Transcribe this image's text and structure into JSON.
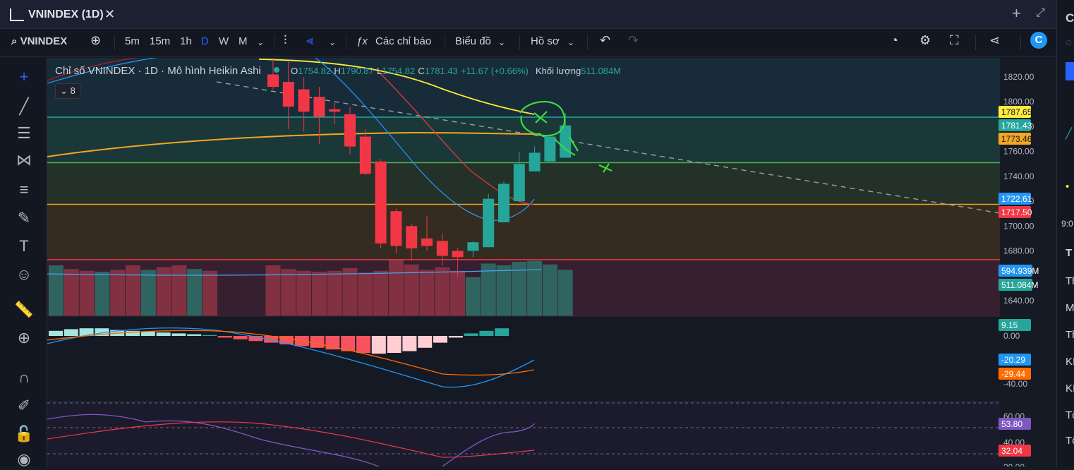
{
  "window": {
    "title": "VNINDEX (1D)",
    "close_glyph": "✕",
    "plus_glyph": "+",
    "expand_glyph": "⤢"
  },
  "toolbar": {
    "symbol": "VNINDEX",
    "intervals": [
      "5m",
      "15m",
      "1h",
      "D",
      "W",
      "M"
    ],
    "active_interval": "D",
    "indicators_label": "Các chỉ báo",
    "chart_type_label": "Biểu đồ",
    "profile_label": "Hồ sơ"
  },
  "legend": {
    "title": "Chỉ số VNINDEX · 1D · Mô hình Heikin Ashi",
    "o_label": "O",
    "o": "1754.82",
    "h_label": "H",
    "h": "1790.87",
    "l_label": "L",
    "l": "1754.82",
    "c_label": "C",
    "c": "1781.43",
    "change": "+11.67 (+0.66%)",
    "volume_label": "Khối lượng",
    "volume": "511.084M",
    "collapsed_count": "8"
  },
  "price_axis": [
    "1820.00",
    "1800.00",
    "1780.00",
    "1760.00",
    "1740.00",
    "1720.00",
    "1700.00",
    "1680.00",
    "1640.00"
  ],
  "macd_axis": [
    "0.00",
    "-40.00"
  ],
  "rsi_axis": [
    "60.00",
    "40.00",
    "20.00"
  ],
  "price_tags": [
    {
      "text": "1787.65",
      "bg": "#ffeb3b",
      "fg": "#131722"
    },
    {
      "text": "1781.43",
      "bg": "#26a69a",
      "fg": "#ffffff"
    },
    {
      "text": "1773.46",
      "bg": "#f5a623",
      "fg": "#131722"
    },
    {
      "text": "1722.61",
      "bg": "#2196f3",
      "fg": "#ffffff"
    },
    {
      "text": "1717.50",
      "bg": "#f23645",
      "fg": "#ffffff"
    },
    {
      "text": "594.939M",
      "bg": "#2196f3",
      "fg": "#ffffff"
    },
    {
      "text": "511.084M",
      "bg": "#26a69a",
      "fg": "#ffffff"
    },
    {
      "text": "9.15",
      "bg": "#26a69a",
      "fg": "#ffffff"
    },
    {
      "text": "-20.29",
      "bg": "#2196f3",
      "fg": "#ffffff"
    },
    {
      "text": "-29.44",
      "bg": "#ff6d00",
      "fg": "#ffffff"
    },
    {
      "text": "53.80",
      "bg": "#7e57c2",
      "fg": "#ffffff"
    },
    {
      "text": "32.04",
      "bg": "#f23645",
      "fg": "#ffffff"
    }
  ],
  "right_panel_fragments": [
    "C",
    "9:0",
    "T",
    "Th",
    "M",
    "Th",
    "KI",
    "KI",
    "Tổ",
    "Tổ"
  ],
  "colors": {
    "up": "#26a69a",
    "down": "#f23645",
    "accent": "#2962ff",
    "ma_yellow": "#ffeb3b",
    "ma_orange": "#f5a623",
    "ma_blue": "#2196f3",
    "rsi": "#7e57c2"
  },
  "chart_data": {
    "type": "candlestick",
    "title": "Chỉ số VNINDEX · 1D · Mô hình Heikin Ashi",
    "ylim": [
      1630,
      1830
    ],
    "candles": [
      {
        "o": 1822,
        "h": 1836,
        "l": 1810,
        "c": 1812
      },
      {
        "o": 1816,
        "h": 1832,
        "l": 1778,
        "c": 1796
      },
      {
        "o": 1810,
        "h": 1820,
        "l": 1776,
        "c": 1792
      },
      {
        "o": 1804,
        "h": 1812,
        "l": 1766,
        "c": 1788
      },
      {
        "o": 1794,
        "h": 1800,
        "l": 1782,
        "c": 1792
      },
      {
        "o": 1790,
        "h": 1796,
        "l": 1758,
        "c": 1764
      },
      {
        "o": 1772,
        "h": 1778,
        "l": 1741,
        "c": 1742
      },
      {
        "o": 1752,
        "h": 1754,
        "l": 1682,
        "c": 1686
      },
      {
        "o": 1712,
        "h": 1714,
        "l": 1678,
        "c": 1684
      },
      {
        "o": 1700,
        "h": 1702,
        "l": 1672,
        "c": 1682
      },
      {
        "o": 1690,
        "h": 1708,
        "l": 1680,
        "c": 1684
      },
      {
        "o": 1688,
        "h": 1694,
        "l": 1668,
        "c": 1676
      },
      {
        "o": 1680,
        "h": 1682,
        "l": 1659,
        "c": 1675
      },
      {
        "o": 1680,
        "h": 1688,
        "l": 1675,
        "c": 1687
      },
      {
        "o": 1683,
        "h": 1726,
        "l": 1683,
        "c": 1722
      },
      {
        "o": 1703,
        "h": 1736,
        "l": 1703,
        "c": 1734
      },
      {
        "o": 1720,
        "h": 1760,
        "l": 1720,
        "c": 1750
      },
      {
        "o": 1744,
        "h": 1764,
        "l": 1744,
        "c": 1759
      },
      {
        "o": 1752,
        "h": 1774,
        "l": 1752,
        "c": 1772
      },
      {
        "o": 1755,
        "h": 1791,
        "l": 1755,
        "c": 1781
      }
    ],
    "volume_millions": [
      560,
      520,
      500,
      490,
      500,
      530,
      480,
      500,
      620,
      570,
      510,
      540,
      500,
      430,
      580,
      560,
      600,
      610,
      570,
      511
    ],
    "horizontal_levels": [
      {
        "value": 1787.65,
        "color": "#26a69a"
      },
      {
        "value": 1751,
        "color": "#4caf50"
      },
      {
        "value": 1717.5,
        "color": "#f5a623"
      },
      {
        "value": 1673,
        "color": "#f23645"
      }
    ]
  }
}
